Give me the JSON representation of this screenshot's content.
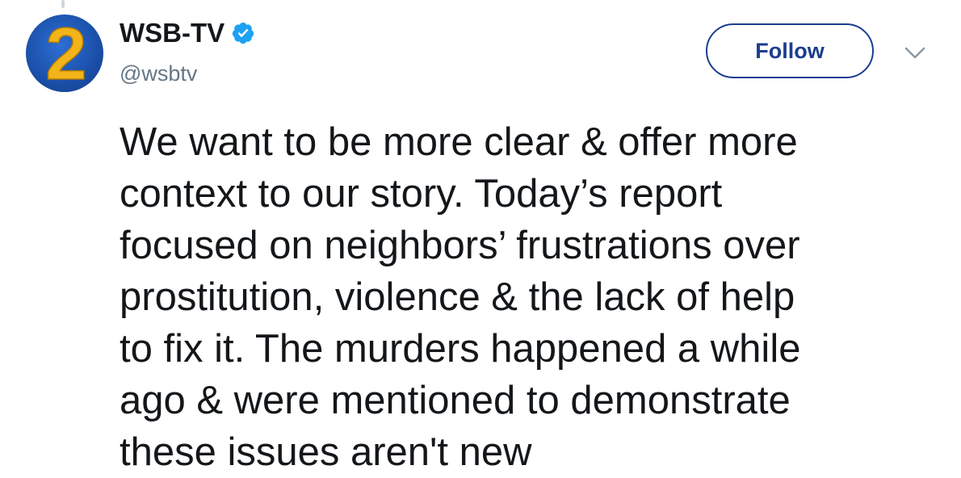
{
  "account": {
    "display_name": "WSB-TV",
    "handle": "@wsbtv",
    "verified": true,
    "avatar_label": "2"
  },
  "actions": {
    "follow_label": "Follow",
    "more_icon": "chevron-down-icon"
  },
  "tweet": {
    "lines": [
      "We want to be more clear & offer more",
      "context to our story. Today’s report",
      "focused on neighbors’ frustrations over",
      "prostitution, violence & the lack of help",
      "to fix it. The murders happened a while",
      "ago & were mentioned to demonstrate",
      "these issues aren't new"
    ]
  },
  "colors": {
    "accent": "#1b3d8f",
    "verified": "#1da1f2",
    "text": "#14171a",
    "muted": "#657786",
    "avatar_blue": "#1a4fa8",
    "avatar_gold": "#f2b418"
  }
}
